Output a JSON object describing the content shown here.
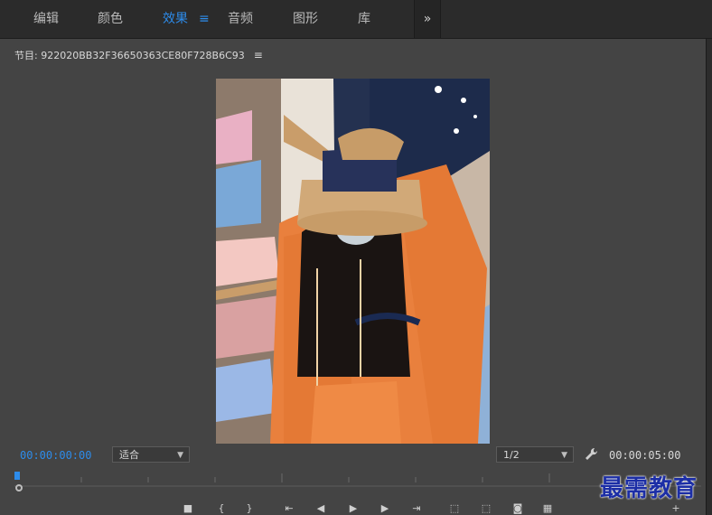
{
  "tabs": [
    {
      "label": "编辑",
      "active": false
    },
    {
      "label": "颜色",
      "active": false
    },
    {
      "label": "效果",
      "active": true
    },
    {
      "label": "音频",
      "active": false
    },
    {
      "label": "图形",
      "active": false
    },
    {
      "label": "库",
      "active": false
    }
  ],
  "active_tab_menu_glyph": "≡",
  "overflow_glyph": "»",
  "program": {
    "title": "节目: 922020BB32F36650363CE80F728B6C93",
    "menu_glyph": "≡"
  },
  "timecode": {
    "current": "00:00:00:00",
    "duration": "00:00:05:00"
  },
  "fit_select": {
    "value": "适合"
  },
  "resolution_select": {
    "value": "1/2"
  },
  "watermark": "最需教育",
  "colors": {
    "accent_blue": "#2d8ceb",
    "panel_bg": "#444444",
    "topbar_bg": "#2b2b2b"
  },
  "icons": {
    "settings": "wrench-icon",
    "controls": [
      "stop-icon",
      "mark-in-icon",
      "mark-out-icon",
      "go-to-in-icon",
      "step-back-icon",
      "play-icon",
      "step-forward-icon",
      "go-to-out-icon",
      "lift-icon",
      "extract-icon",
      "export-frame-icon",
      "button-editor-icon",
      "add-icon"
    ]
  }
}
